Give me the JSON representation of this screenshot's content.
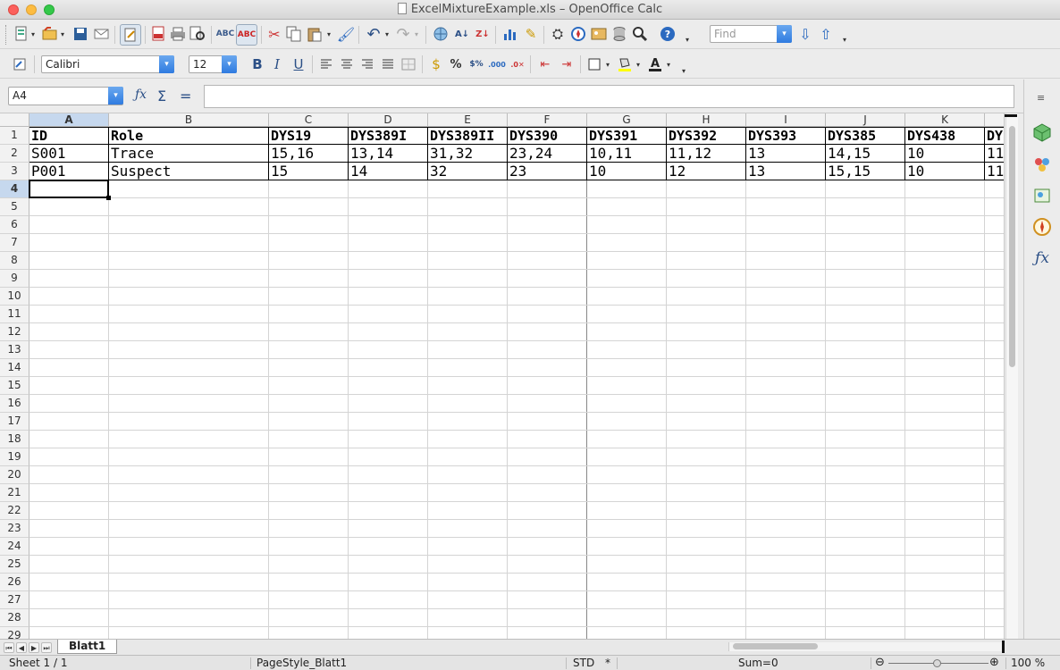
{
  "window": {
    "title": "ExcelMixtureExample.xls – OpenOffice Calc"
  },
  "toolbar_format": {
    "font_name": "Calibri",
    "font_size": "12",
    "bold": "B",
    "italic": "I",
    "underline": "U"
  },
  "toolbar_standard": {
    "find_placeholder": "Find"
  },
  "formula_bar": {
    "name_box": "A4",
    "content": ""
  },
  "sheet": {
    "columns": [
      "A",
      "B",
      "C",
      "D",
      "E",
      "F",
      "G",
      "H",
      "I",
      "J",
      "K",
      "L"
    ],
    "selected_column": "A",
    "rows": [
      "1",
      "2",
      "3",
      "4",
      "5",
      "6",
      "7",
      "8",
      "9",
      "10",
      "11",
      "12",
      "13",
      "14",
      "15",
      "16",
      "17",
      "18",
      "19",
      "20",
      "21",
      "22",
      "23",
      "24",
      "25",
      "26",
      "27",
      "28",
      "29"
    ],
    "selected_row": "4",
    "selected_cell": "A4",
    "cells": [
      [
        "ID",
        "Role",
        "DYS19",
        "DYS389I",
        "DYS389II",
        "DYS390",
        "DYS391",
        "DYS392",
        "DYS393",
        "DYS385",
        "DYS438",
        "DYS"
      ],
      [
        "S001",
        "Trace",
        "15,16",
        "13,14",
        "31,32",
        "23,24",
        "10,11",
        "11,12",
        "13",
        "14,15",
        "10",
        "11"
      ],
      [
        "P001",
        "Suspect",
        "15",
        "14",
        "32",
        "23",
        "10",
        "12",
        "13",
        "15,15",
        "10",
        "11"
      ]
    ]
  },
  "tabs": {
    "active": "Blatt1"
  },
  "status_bar": {
    "sheet_pos": "Sheet 1 / 1",
    "page_style": "PageStyle_Blatt1",
    "mode": "STD",
    "modified": "*",
    "sum": "Sum=0",
    "zoom": "100 %",
    "zoom_out": "⊖",
    "zoom_in": "⊕"
  },
  "icons": {
    "toolbar_standard": [
      "new-document-icon",
      "open-icon",
      "save-icon",
      "send-mail-icon",
      "edit-file-icon",
      "export-pdf-icon",
      "print-icon",
      "print-preview-icon",
      "spellcheck-icon",
      "autospellcheck-icon",
      "cut-icon",
      "copy-icon",
      "paste-icon",
      "clone-formatting-icon",
      "undo-icon",
      "redo-icon",
      "hyperlink-icon",
      "sort-ascending-icon",
      "sort-descending-icon",
      "chart-icon",
      "draw-icon",
      "find-replace-icon",
      "navigator-icon",
      "gallery-icon",
      "data-sources-icon",
      "zoom-icon",
      "help-icon"
    ],
    "sidebar": [
      "properties-icon",
      "styles-icon",
      "gallery-icon",
      "navigator-icon",
      "functions-icon"
    ]
  }
}
